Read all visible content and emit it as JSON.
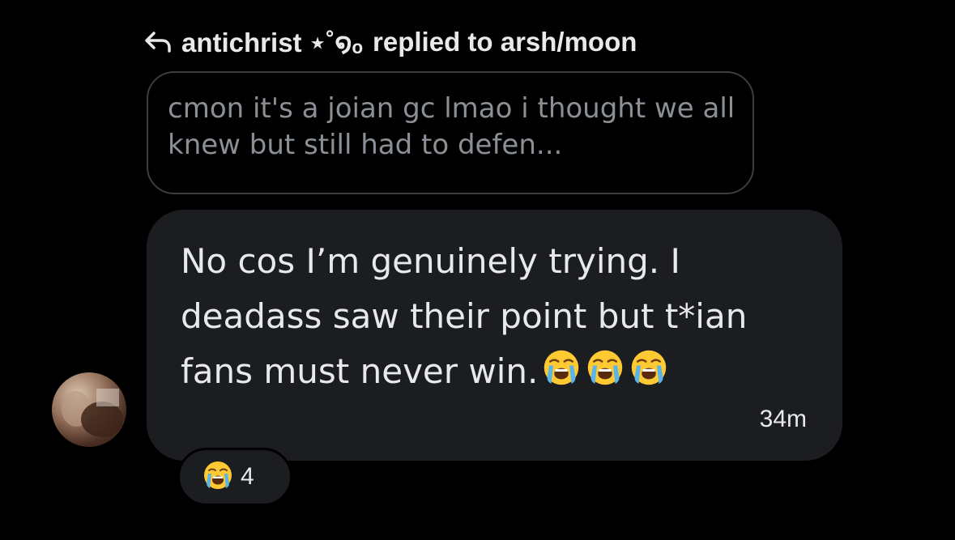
{
  "reply_header": {
    "username": "antichrist ⋆˚໑ₒ",
    "action_text": "replied to arsh/moon"
  },
  "quoted_message": {
    "text": "cmon it's a joian gc lmao i thought we all knew but still had to defen..."
  },
  "message": {
    "text": "No cos I’m genuinely trying. I deadass saw their point but t*ian fans must never win.",
    "emojis": [
      "loudly-crying-face",
      "loudly-crying-face",
      "loudly-crying-face"
    ],
    "timestamp": "34m"
  },
  "reaction": {
    "emoji": "loudly-crying-face",
    "count": "4"
  },
  "colors": {
    "background": "#000000",
    "bubble": "#1c1d20",
    "quote_border": "#3a3d42",
    "quote_text": "#8b9096",
    "text": "#e7e9ea",
    "emoji_face": "#ffc933",
    "emoji_tears": "#5ab4e8"
  }
}
